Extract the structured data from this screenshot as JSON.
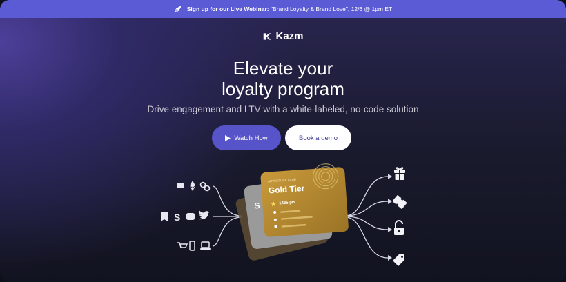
{
  "banner": {
    "bold": "Sign up for our Live Webinar:",
    "text": "\"Brand Loyalty & Brand Love\", 12/6 @ 1pm ET",
    "icon": "rocket-icon"
  },
  "logo": {
    "name": "Kazm"
  },
  "hero": {
    "headline_line1": "Elevate your",
    "headline_line2": "loyalty program",
    "subhead": "Drive engagement and LTV with a white-labeled, no-code solution"
  },
  "buttons": {
    "watch": "Watch How",
    "demo": "Book a demo"
  },
  "card": {
    "club": "ADVENTURE CLUB",
    "tier": "Gold Tier",
    "points": "1435 pts",
    "back_label": "S"
  },
  "colors": {
    "banner": "#5b5bd6",
    "primary_button": "#5654c8",
    "gold": "#b88b2e"
  },
  "left_icons": [
    "wallet-icon",
    "ethereum-icon",
    "link-icon",
    "bookmark-icon",
    "shopify-icon",
    "discord-icon",
    "twitter-icon",
    "cart-icon",
    "phone-icon",
    "laptop-icon"
  ],
  "right_icons": [
    "gift-icon",
    "ticket-icon",
    "unlock-icon",
    "tag-icon"
  ]
}
